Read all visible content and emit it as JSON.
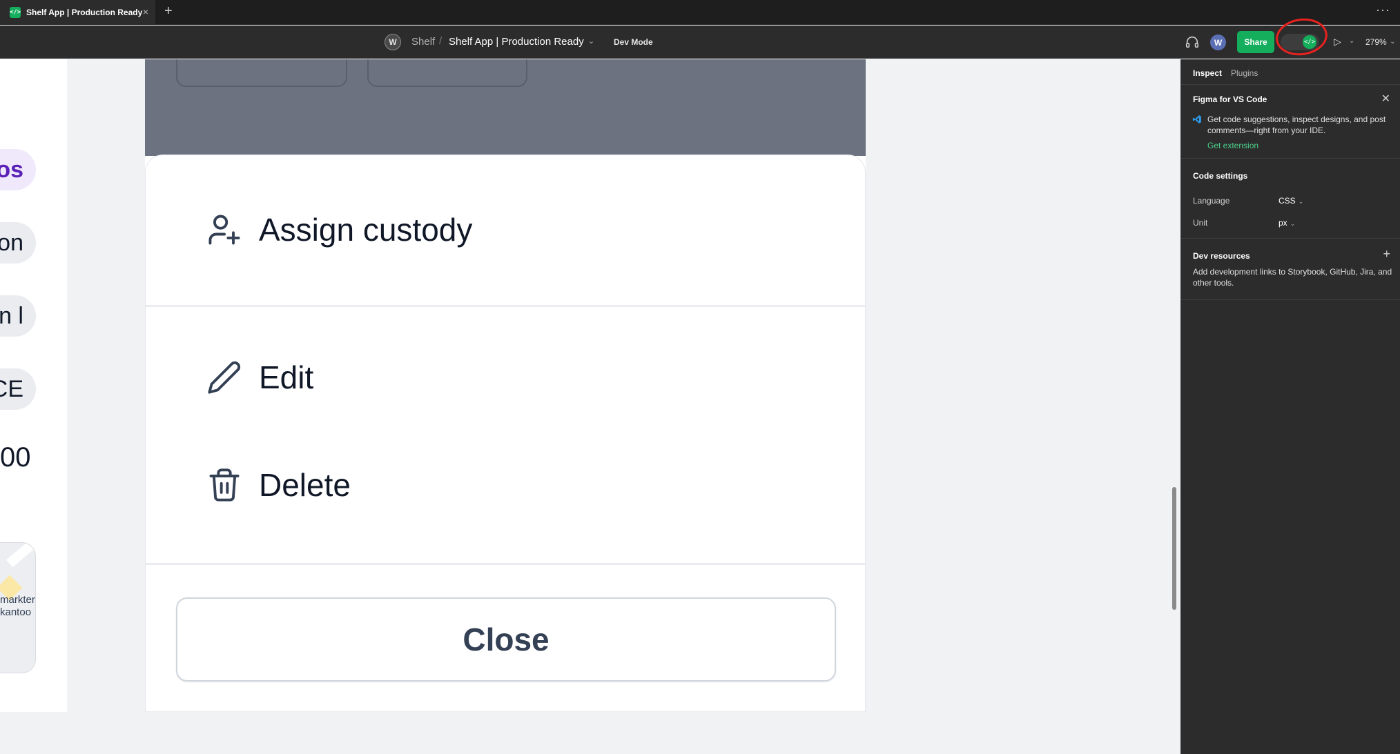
{
  "tabbar": {
    "tab_title": "Shelf App | Production Ready",
    "tab_icon_glyph": "</>",
    "close_glyph": "×",
    "new_tab_glyph": "+",
    "more_glyph": "···"
  },
  "toolbar": {
    "workspace_initial": "W",
    "project": "Shelf",
    "separator": "/",
    "file_name": "Shelf App | Production Ready",
    "dev_mode_label": "Dev Mode",
    "user_initial": "W",
    "share_label": "Share",
    "devmode_glyph": "</>",
    "zoom": "279%",
    "present_glyph": "▷",
    "chevron_glyph": "⌄"
  },
  "canvas": {
    "left_pills": [
      "os",
      "on",
      "n l",
      "CE"
    ],
    "left_number": "00",
    "map_text_line1": "markter",
    "map_text_line2": "kantoo",
    "ghost_label": "...",
    "sheet": {
      "item_assign": "Assign custody",
      "item_edit": "Edit",
      "item_delete": "Delete",
      "close_button": "Close"
    }
  },
  "panel": {
    "tab_inspect": "Inspect",
    "tab_plugins": "Plugins",
    "vscode": {
      "title": "Figma for VS Code",
      "description": "Get code suggestions, inspect designs, and post comments—right from your IDE.",
      "link": "Get extension"
    },
    "code_settings": {
      "title": "Code settings",
      "language_label": "Language",
      "language_value": "CSS",
      "unit_label": "Unit",
      "unit_value": "px"
    },
    "dev_resources": {
      "title": "Dev resources",
      "description": "Add development links to Storybook, GitHub, Jira, and other tools."
    }
  },
  "colors": {
    "accent_green": "#14ae5c",
    "annotation_red": "#e8221f",
    "purple_pill_text": "#5b21b6"
  }
}
